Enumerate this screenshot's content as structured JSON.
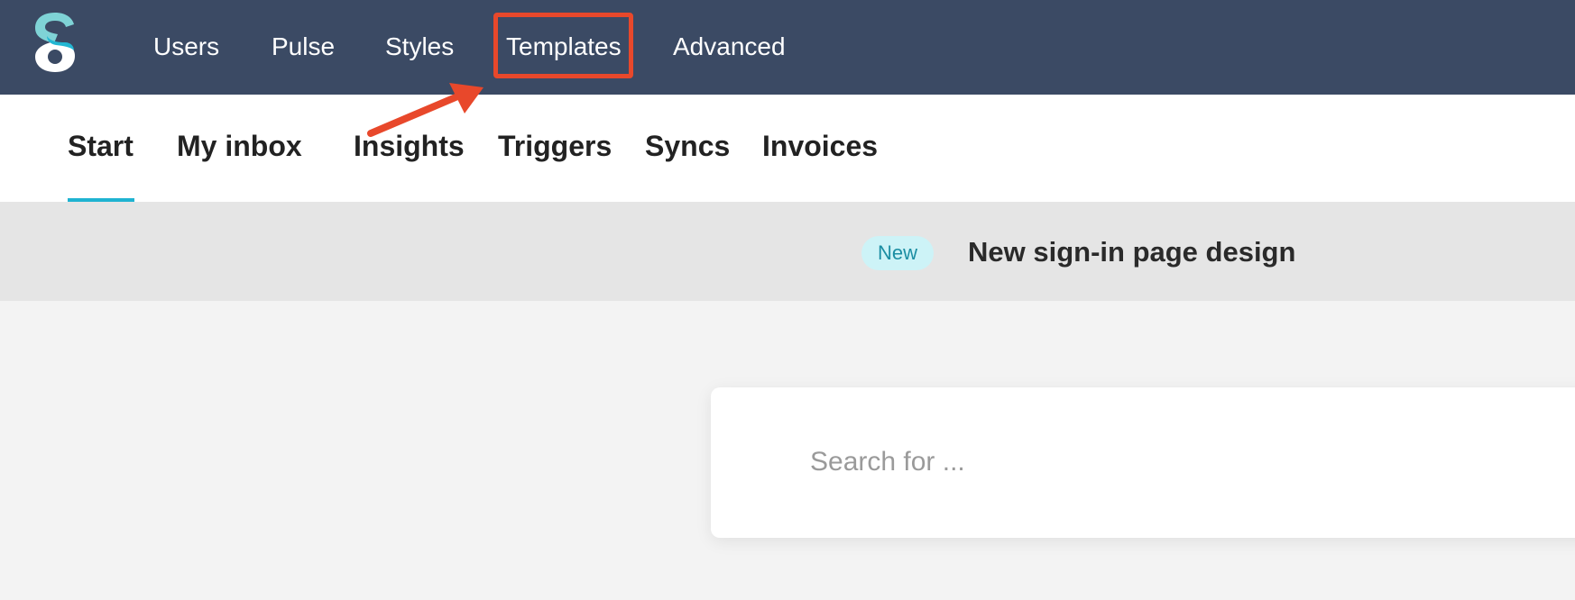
{
  "colors": {
    "topbar": "#3b4a64",
    "accent": "#1fb3d1",
    "annotation": "#e8482b",
    "badge_bg": "#cdf3f7",
    "badge_text": "#1c8ea3"
  },
  "logo": {
    "icon": "brand-s-logo-icon"
  },
  "topnav": {
    "items": [
      {
        "label": "Users"
      },
      {
        "label": "Pulse"
      },
      {
        "label": "Styles"
      },
      {
        "label": "Templates"
      },
      {
        "label": "Advanced"
      }
    ],
    "highlighted": "Templates"
  },
  "subnav": {
    "items": [
      {
        "label": "Start"
      },
      {
        "label": "My inbox"
      },
      {
        "label": "Insights"
      },
      {
        "label": "Triggers"
      },
      {
        "label": "Syncs"
      },
      {
        "label": "Invoices"
      }
    ],
    "active": "Start"
  },
  "banner": {
    "badge": "New",
    "title": "New sign-in page design"
  },
  "search": {
    "value": "",
    "placeholder": "Search for ..."
  }
}
